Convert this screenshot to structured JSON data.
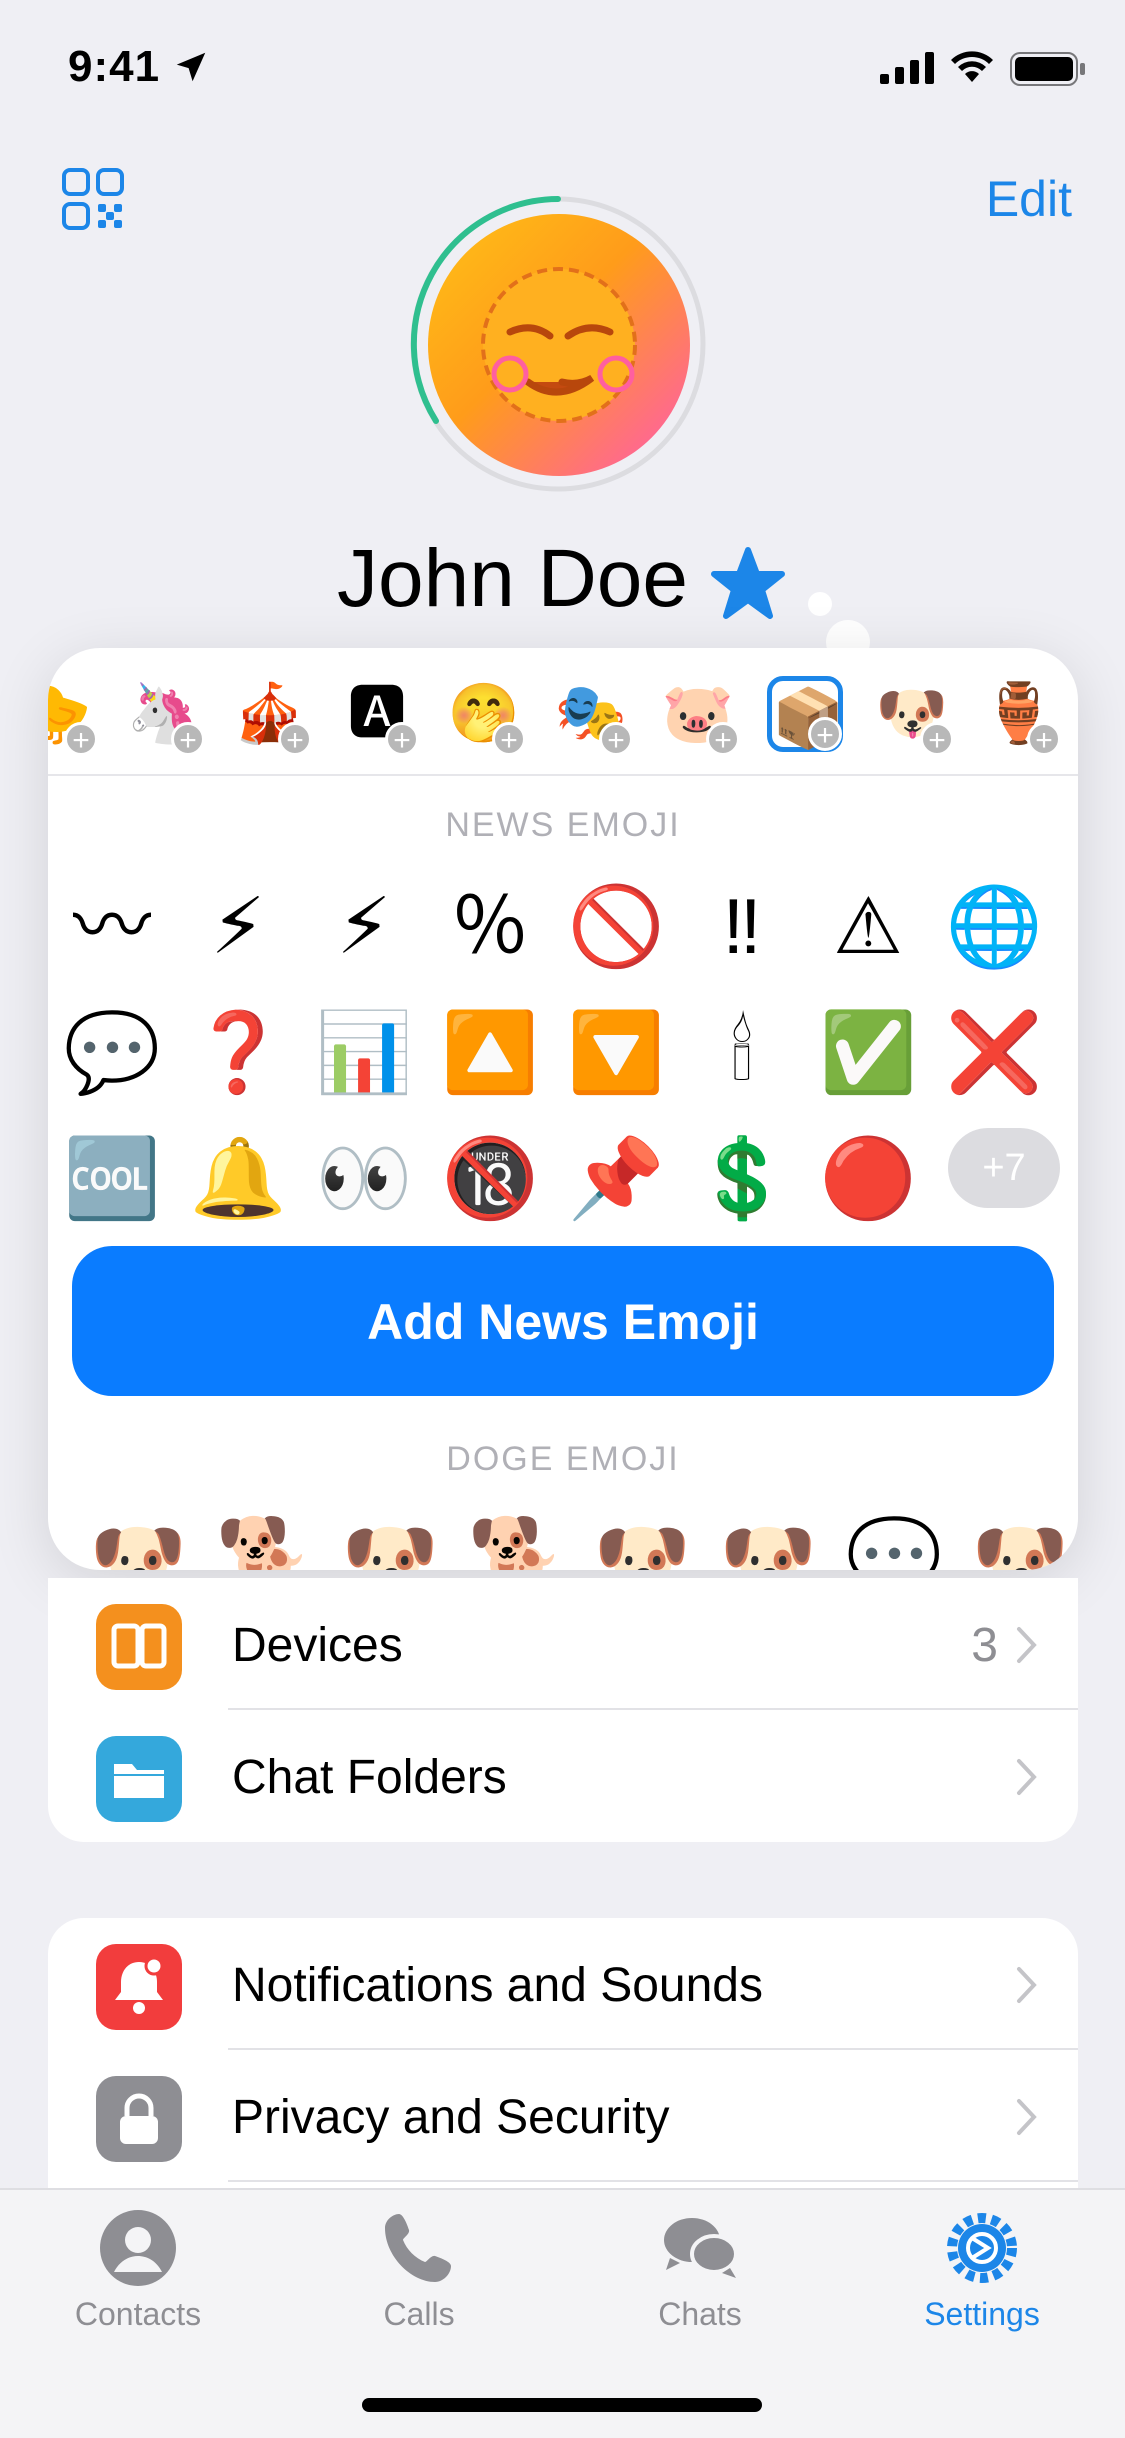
{
  "status_bar": {
    "time": "9:41"
  },
  "header": {
    "edit_label": "Edit",
    "qr_icon": "qr-code-icon"
  },
  "profile": {
    "name": "John Doe",
    "emoji_status": "star-icon"
  },
  "emoji_panel": {
    "packs": [
      "🐤",
      "🦄",
      "🎪",
      "🅰",
      "🤭",
      "🎭",
      "🐷",
      "📦",
      "🐶",
      "🏺"
    ],
    "news_title": "NEWS EMOJI",
    "news_emojis": [
      "〰",
      "⚡",
      "⚡",
      "％",
      "🚫",
      "‼",
      "⚠",
      "🌐",
      "💬",
      "❓",
      "📊",
      "🔼",
      "🔽",
      "🕯",
      "✅",
      "❌",
      "🆒",
      "🔔",
      "👀",
      "🔞",
      "📌",
      "💲",
      "🔴"
    ],
    "more_label": "+7",
    "add_button_label": "Add News Emoji",
    "doge_title": "DOGE EMOJI",
    "doge_emojis": [
      "🐶",
      "🐕",
      "🐶",
      "🐕",
      "🐶",
      "🐶",
      "💬",
      "🐶"
    ]
  },
  "settings_group1": {
    "items": [
      {
        "label": "Devices",
        "value": "3",
        "icon": "devices-icon",
        "color": "#f4901e"
      },
      {
        "label": "Chat Folders",
        "value": "",
        "icon": "folder-icon",
        "color": "#34a8dc"
      }
    ]
  },
  "settings_group2": {
    "items": [
      {
        "label": "Notifications and Sounds",
        "icon": "bell-icon",
        "color": "#f23d3d"
      },
      {
        "label": "Privacy and Security",
        "icon": "lock-icon",
        "color": "#8e8e93"
      }
    ]
  },
  "tabs": [
    {
      "label": "Contacts",
      "icon": "person-icon",
      "active": false
    },
    {
      "label": "Calls",
      "icon": "phone-icon",
      "active": false
    },
    {
      "label": "Chats",
      "icon": "chat-bubbles-icon",
      "active": false
    },
    {
      "label": "Settings",
      "icon": "gear-icon",
      "active": true
    }
  ],
  "accent_color": "#1c86e8"
}
